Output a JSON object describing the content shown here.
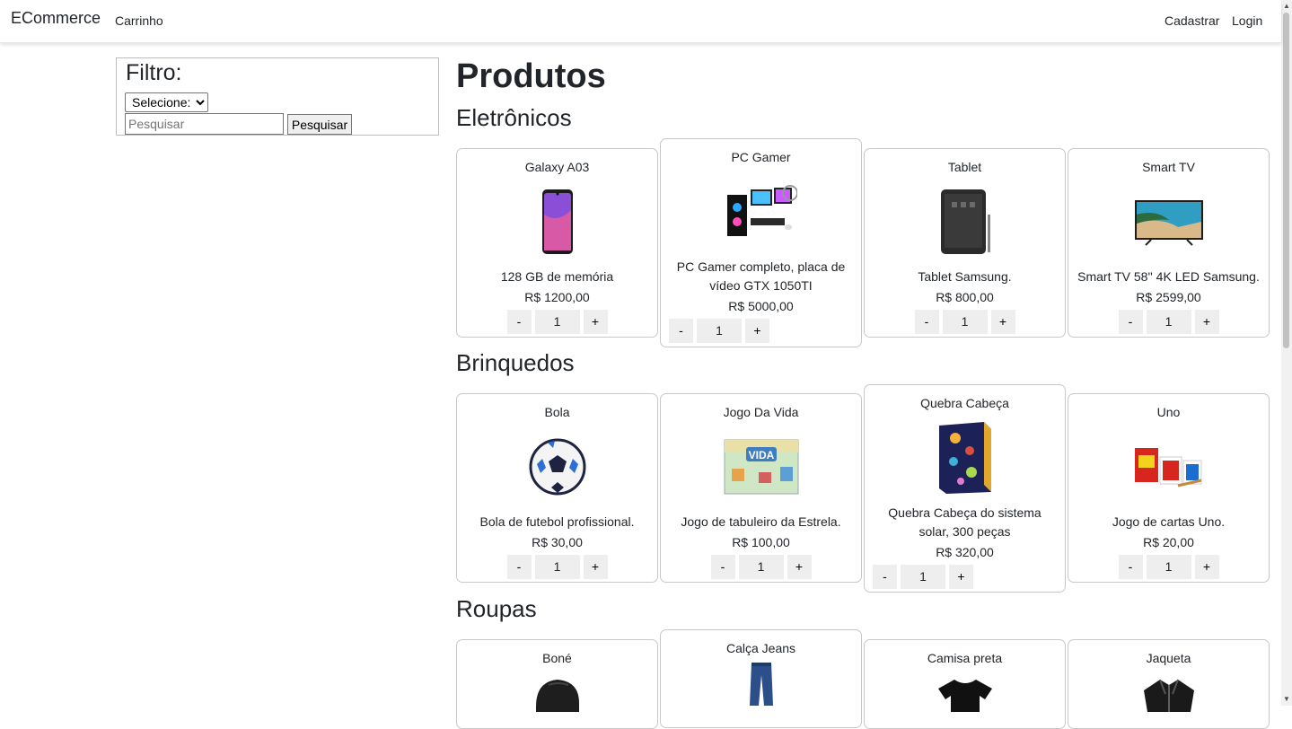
{
  "navbar": {
    "brand": "ECommerce",
    "cart": "Carrinho",
    "register": "Cadastrar",
    "login": "Login"
  },
  "filter": {
    "title": "Filtro:",
    "select_value": "Selecione:",
    "search_placeholder": "Pesquisar",
    "search_button": "Pesquisar"
  },
  "page_title": "Produtos",
  "sections": [
    {
      "title": "Eletrônicos",
      "products": [
        {
          "name": "Galaxy A03",
          "description": "128 GB de memória",
          "price": "R$ 1200,00",
          "quantity": "1",
          "icon": "smartphone-icon"
        },
        {
          "name": "PC Gamer",
          "description": "PC Gamer completo, placa de vídeo GTX 1050TI",
          "price": "R$ 5000,00",
          "quantity": "1",
          "icon": "desktop-computer-icon"
        },
        {
          "name": "Tablet",
          "description": "Tablet Samsung.",
          "price": "R$ 800,00",
          "quantity": "1",
          "icon": "tablet-icon"
        },
        {
          "name": "Smart TV",
          "description": "Smart TV 58'' 4K LED Samsung.",
          "price": "R$ 2599,00",
          "quantity": "1",
          "icon": "television-icon"
        }
      ]
    },
    {
      "title": "Brinquedos",
      "products": [
        {
          "name": "Bola",
          "description": "Bola de futebol profissional.",
          "price": "R$ 30,00",
          "quantity": "1",
          "icon": "soccer-ball-icon"
        },
        {
          "name": "Jogo Da Vida",
          "description": "Jogo de tabuleiro da Estrela.",
          "price": "R$ 100,00",
          "quantity": "1",
          "icon": "board-game-box-icon"
        },
        {
          "name": "Quebra Cabeça",
          "description": "Quebra Cabeça do sistema solar, 300 peças",
          "price": "R$ 320,00",
          "quantity": "1",
          "icon": "puzzle-box-icon"
        },
        {
          "name": "Uno",
          "description": "Jogo de cartas Uno.",
          "price": "R$ 20,00",
          "quantity": "1",
          "icon": "card-game-icon"
        }
      ]
    },
    {
      "title": "Roupas",
      "products": [
        {
          "name": "Boné",
          "icon": "cap-icon"
        },
        {
          "name": "Calça Jeans",
          "icon": "jeans-icon"
        },
        {
          "name": "Camisa preta",
          "icon": "tshirt-icon"
        },
        {
          "name": "Jaqueta",
          "icon": "jacket-icon"
        }
      ]
    }
  ],
  "quantity_controls": {
    "minus": "-",
    "plus": "+"
  },
  "colors": {
    "border": "#c8c8c8",
    "control_bg": "#eeeeee",
    "text": "#212529"
  }
}
